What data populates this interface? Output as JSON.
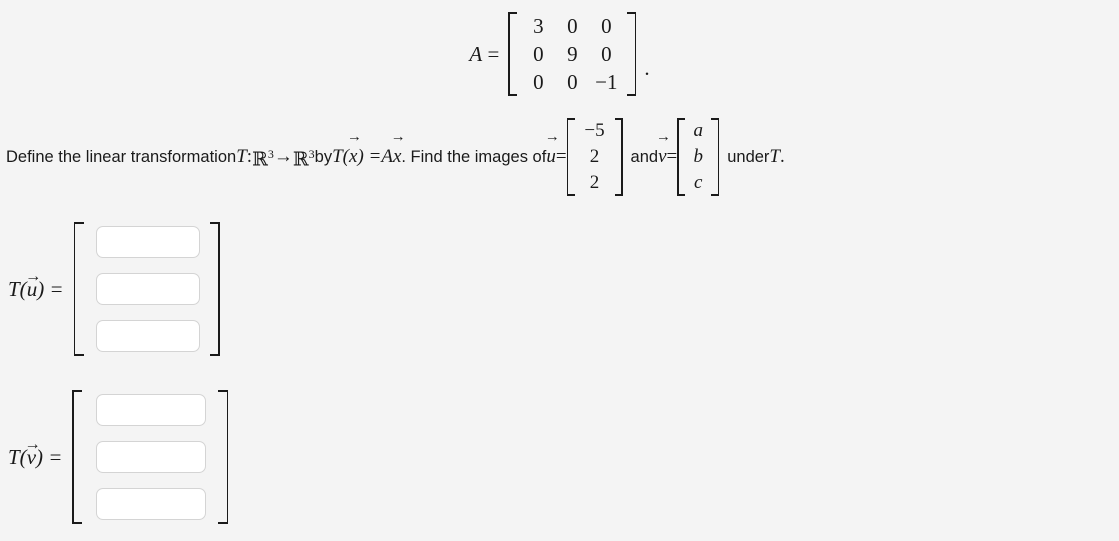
{
  "problem": {
    "matrix_a": {
      "label": "A",
      "equals": "=",
      "rows": [
        [
          "3",
          "0",
          "0"
        ],
        [
          "0",
          "9",
          "0"
        ],
        [
          "0",
          "0",
          "−1"
        ]
      ],
      "trailing_period": "."
    },
    "statement": {
      "part1": "Define the linear transformation ",
      "t_symbol": "T",
      "colon": " : ",
      "domain_base": "ℝ",
      "domain_exp": "3",
      "arrow": " → ",
      "codomain_base": "ℝ",
      "codomain_exp": "3",
      "part2": " by ",
      "definition": "T(x⃗) = Ax⃗",
      "t_of_x_left": "T(",
      "x_vec": "x",
      "t_of_x_right": ") = ",
      "a_x": "Ax",
      "part3": ". Find the images of ",
      "u_label": "u",
      "u_equals": " = ",
      "u_vector": [
        "−5",
        "2",
        "2"
      ],
      "and_text": "and ",
      "v_label": "v",
      "v_equals": " = ",
      "v_vector": [
        "a",
        "b",
        "c"
      ],
      "part4": " under ",
      "under_t": "T",
      "final_period": "."
    }
  },
  "answers": {
    "u_row": {
      "label_left": "T(",
      "label_vec": "u",
      "label_right": ") =",
      "inputs": [
        {
          "value": "",
          "placeholder": ""
        },
        {
          "value": "",
          "placeholder": ""
        },
        {
          "value": "",
          "placeholder": ""
        }
      ]
    },
    "v_row": {
      "label_left": "T(",
      "label_vec": "v",
      "label_right": ") =",
      "inputs": [
        {
          "value": "",
          "placeholder": ""
        },
        {
          "value": "",
          "placeholder": ""
        },
        {
          "value": "",
          "placeholder": ""
        }
      ]
    }
  },
  "theme": {
    "background": "#f4f4f4",
    "text_color": "#1a1a1a",
    "input_border": "#d4d4d4",
    "input_background": "#ffffff"
  }
}
